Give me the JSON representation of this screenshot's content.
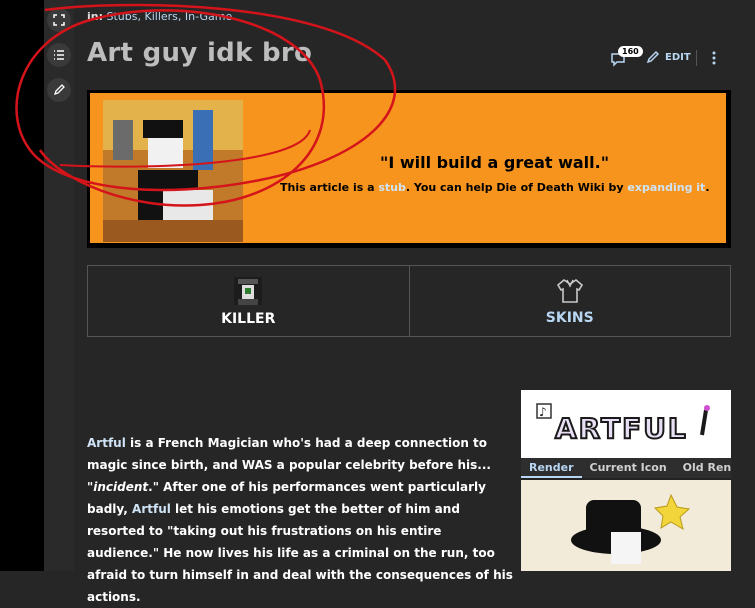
{
  "categories": {
    "prefix": "in:",
    "list": "Stubs, Killers, In-Game"
  },
  "page_title": "Art guy idk bro",
  "tools": {
    "comments_count": "160",
    "edit_label": "EDIT"
  },
  "banner": {
    "quote": "\"I will build a great wall.\"",
    "stub_pre": "This article is a ",
    "stub_link": "stub",
    "stub_mid": ". You can help Die of Death Wiki by ",
    "stub_link2": "expanding it",
    "stub_end": "."
  },
  "nav_tabs": [
    {
      "label": "KILLER"
    },
    {
      "label": "SKINS"
    }
  ],
  "article": {
    "name": "Artful",
    "t1": " is a French Magician who's had a deep connection to magic since birth, and WAS a popular celebrity before his... \"",
    "t1_italic": "incident",
    "t2": ".\" After one of his performances went particularly badly, ",
    "name2": "Artful",
    "t3": " let his emotions get the better of him and resorted to \"taking out his frustrations on his entire audience.\" He now lives his life as a criminal on the run, too afraid to turn himself in and deal with the consequences of his actions."
  },
  "infobox": {
    "logo_text": "ARTFUL",
    "tabs": [
      "Render",
      "Current Icon",
      "Old Ren"
    ]
  },
  "colors": {
    "banner_orange": "#f7941d",
    "link": "#b8d6f2",
    "scribble": "#d4141a"
  }
}
